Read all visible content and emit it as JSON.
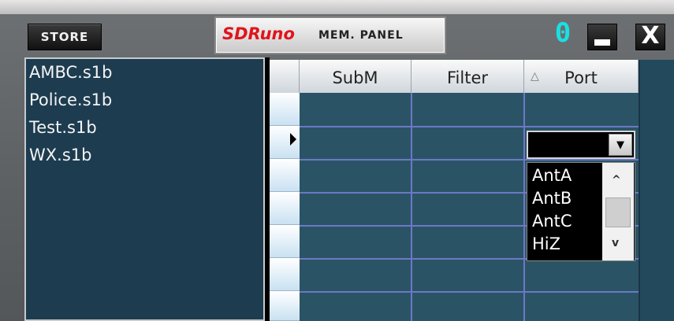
{
  "toolbar": {
    "store_label": "STORE",
    "title_brand": "SDRuno",
    "title_text": "MEM. PANEL",
    "vrx_digit": "0",
    "close_glyph": "X"
  },
  "file_list": [
    "AMBC.s1b",
    "Police.s1b",
    "Test.s1b",
    "WX.s1b"
  ],
  "grid": {
    "columns": [
      "SubM",
      "Filter",
      "Port"
    ],
    "sort_indicator": "△",
    "active_row_marker": "▶"
  },
  "port_dropdown": {
    "selected_value": "",
    "options": [
      "AntA",
      "AntB",
      "AntC",
      "HiZ"
    ]
  },
  "colors": {
    "brand_red": "#e0141b",
    "digit_cyan": "#19e0e3",
    "list_bg": "#1d3c50",
    "grid_bg": "#2a5466"
  },
  "icons": {
    "minimize": "minimize-icon",
    "close": "close-icon",
    "combo_arrow": "chevron-down-icon",
    "scroll_up": "chevron-up-icon",
    "scroll_down": "chevron-down-icon"
  }
}
